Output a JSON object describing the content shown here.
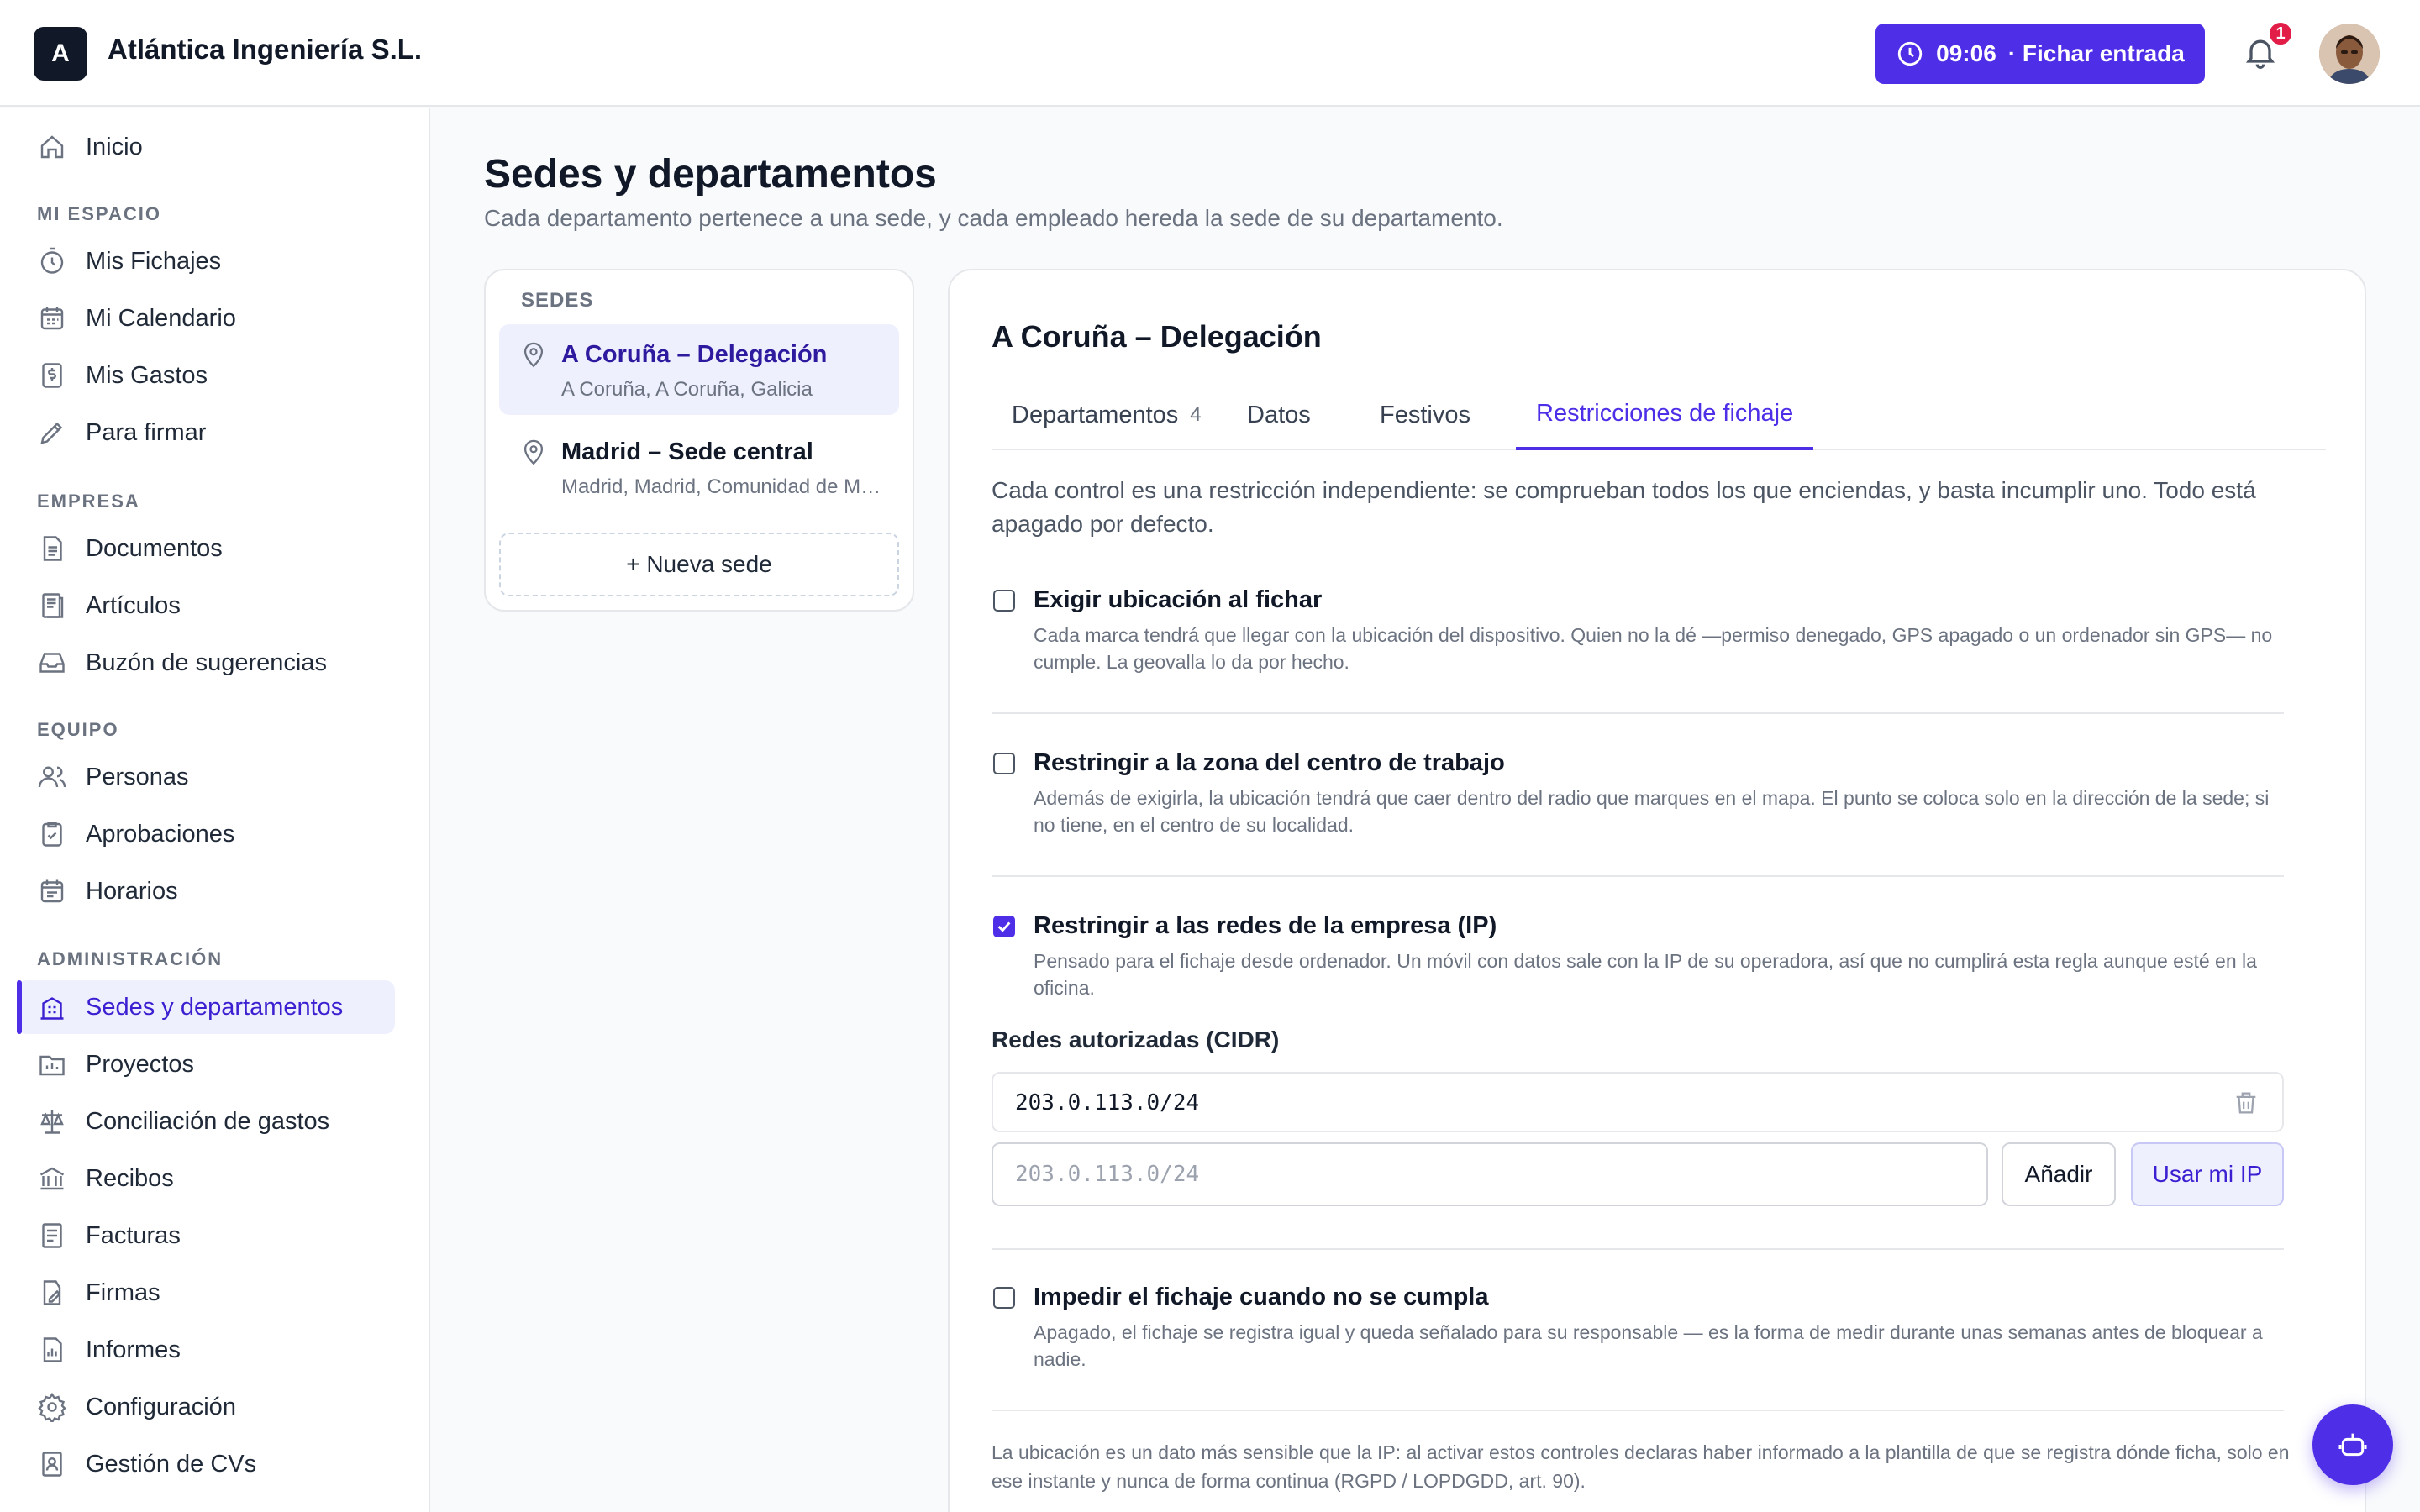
{
  "header": {
    "logo_letter": "A",
    "company": "Atlántica Ingeniería S.L.",
    "clock_time": "09:06",
    "clock_action": "· Fichar entrada",
    "notifications_count": "1"
  },
  "sidebar": {
    "home": "Inicio",
    "sections": {
      "mi_espacio": "MI ESPACIO",
      "empresa": "EMPRESA",
      "equipo": "EQUIPO",
      "administracion": "ADMINISTRACIÓN"
    },
    "mi_espacio": [
      "Mis Fichajes",
      "Mi Calendario",
      "Mis Gastos",
      "Para firmar"
    ],
    "empresa": [
      "Documentos",
      "Artículos",
      "Buzón de sugerencias"
    ],
    "equipo": [
      "Personas",
      "Aprobaciones",
      "Horarios"
    ],
    "administracion": [
      "Sedes y departamentos",
      "Proyectos",
      "Conciliación de gastos",
      "Recibos",
      "Facturas",
      "Firmas",
      "Informes",
      "Configuración",
      "Gestión de CVs"
    ]
  },
  "page": {
    "title": "Sedes y departamentos",
    "subtitle": "Cada departamento pertenece a una sede, y cada empleado hereda la sede de su departamento."
  },
  "sedes": {
    "heading": "SEDES",
    "items": [
      {
        "name": "A Coruña – Delegación",
        "address": "A Coruña, A Coruña, Galicia"
      },
      {
        "name": "Madrid – Sede central",
        "address": "Madrid, Madrid, Comunidad de Madrid"
      }
    ],
    "new_label": "+ Nueva sede"
  },
  "detail": {
    "title": "A Coruña – Delegación",
    "tabs": [
      {
        "label": "Departamentos",
        "count": "4"
      },
      {
        "label": "Datos"
      },
      {
        "label": "Festivos"
      },
      {
        "label": "Restricciones de fichaje"
      }
    ],
    "intro": "Cada control es una restricción independiente: se comprueban todos los que enciendas, y basta incumplir uno. Todo está apagado por defecto.",
    "rules": [
      {
        "title": "Exigir ubicación al fichar",
        "desc": "Cada marca tendrá que llegar con la ubicación del dispositivo. Quien no la dé —permiso denegado, GPS apagado o un ordenador sin GPS— no cumple. La geovalla lo da por hecho.",
        "checked": false
      },
      {
        "title": "Restringir a la zona del centro de trabajo",
        "desc": "Además de exigirla, la ubicación tendrá que caer dentro del radio que marques en el mapa. El punto se coloca solo en la dirección de la sede; si no tiene, en el centro de su localidad.",
        "checked": false
      },
      {
        "title": "Restringir a las redes de la empresa (IP)",
        "desc": "Pensado para el fichaje desde ordenador. Un móvil con datos sale con la IP de su operadora, así que no cumplirá esta regla aunque esté en la oficina.",
        "checked": true
      },
      {
        "title": "Impedir el fichaje cuando no se cumpla",
        "desc": "Apagado, el fichaje se registra igual y queda señalado para su responsable — es la forma de medir durante unas semanas antes de bloquear a nadie.",
        "checked": false
      }
    ],
    "cidr": {
      "label": "Redes autorizadas (CIDR)",
      "entries": [
        "203.0.113.0/24"
      ],
      "placeholder": "203.0.113.0/24",
      "add_label": "Añadir",
      "my_ip_label": "Usar mi IP"
    },
    "footnote": "La ubicación es un dato más sensible que la IP: al activar estos controles declaras haber informado a la plantilla de que se registra dónde ficha, solo en ese instante y nunca de forma continua (RGPD / LOPDGDD, art. 90)."
  },
  "colors": {
    "accent": "#4f2ee8",
    "accent_soft": "#eef0fe",
    "badge": "#e11d48"
  }
}
